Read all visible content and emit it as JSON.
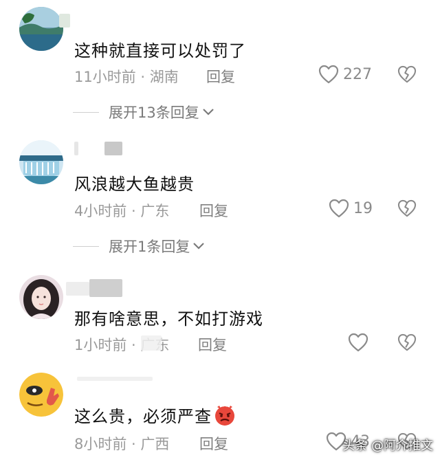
{
  "comments": [
    {
      "content": "这种就直接可以处罚了",
      "time": "11小时前 · 湖南",
      "reply": "回复",
      "likes": "227",
      "expand": "展开13条回复"
    },
    {
      "content": "风浪越大鱼越贵",
      "time": "4小时前 · 广东",
      "reply": "回复",
      "likes": "19",
      "expand": "展开1条回复"
    },
    {
      "content": "那有啥意思，不如打游戏",
      "time": "1小时前 · 广东",
      "reply": "回复",
      "likes": ""
    },
    {
      "content": "这么贵，必须严查",
      "time": "8小时前 · 广西",
      "reply": "回复",
      "likes": "43"
    }
  ],
  "icons": {
    "like": "heart-outline-icon",
    "dislike": "broken-heart-icon",
    "expand": "chevron-down-icon",
    "emoji": "angry-face-emoji"
  },
  "watermark": "头条 @阿介推文",
  "colors": {
    "meta": "#9a9a9a",
    "text": "#111111"
  }
}
